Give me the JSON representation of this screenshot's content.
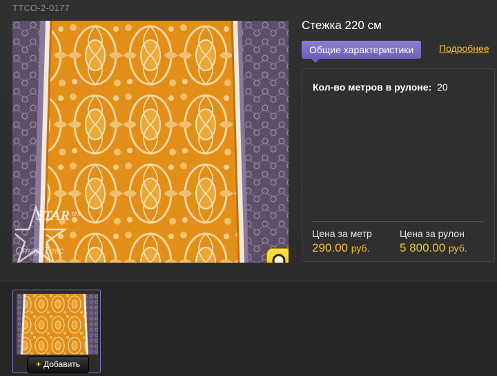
{
  "product": {
    "sku": "ТТСО-2-0177",
    "title": "Стежка 220 см",
    "watermark_logo": "STARtex",
    "watermark_text": "Стар Текс"
  },
  "tabs": {
    "general": "Общие характеристики",
    "more": "Подробнее"
  },
  "specs": {
    "meters_label": "Кол-во метров в рулоне:",
    "meters_value": "20"
  },
  "prices": {
    "per_meter_label": "Цена за метр",
    "per_meter_value": "290.00",
    "per_meter_unit": "руб.",
    "per_roll_label": "Цена за рулон",
    "per_roll_value": "5 800.00",
    "per_roll_unit": "руб."
  },
  "thumbnail": {
    "add_label": "Добавить"
  },
  "colors": {
    "accent": "#f7c21a",
    "tab": "#7a70c8",
    "fabric_orange": "#e8961c",
    "fabric_purple": "#6a5a74"
  },
  "icons": {
    "zoom": "magnifier-icon",
    "add": "plus-icon"
  }
}
